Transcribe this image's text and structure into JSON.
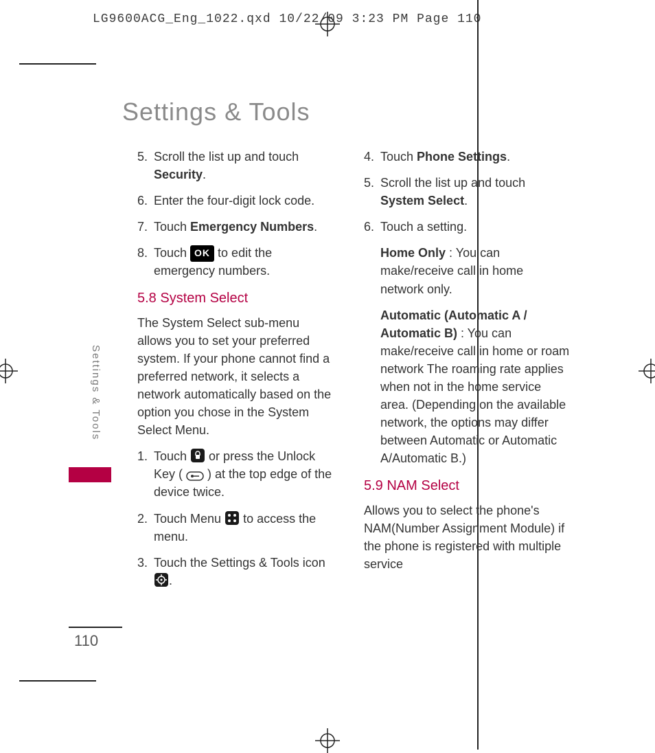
{
  "header_line": "LG9600ACG_Eng_1022.qxd  10/22/09  3:23 PM  Page 110",
  "title": "Settings & Tools",
  "side_tab": "Settings & Tools",
  "page_number": "110",
  "left": {
    "step5": {
      "n": "5.",
      "pre": "Scroll the list up and touch ",
      "bold": "Security",
      "post": "."
    },
    "step6": {
      "n": "6.",
      "body": "Enter the four-digit lock code."
    },
    "step7": {
      "n": "7.",
      "pre": "Touch ",
      "bold": "Emergency Numbers",
      "post": "."
    },
    "step8": {
      "n": "8.",
      "pre": "Touch ",
      "ok": "OK",
      "post": " to edit the emergency numbers."
    },
    "h58": "5.8 System Select",
    "p58": "The System Select sub-menu allows you to set your preferred system. If your phone cannot find a preferred network, it selects a network automatically based on the option you chose in the System Select Menu.",
    "s1": {
      "n": "1.",
      "pre": "Touch ",
      "mid": " or press the Unlock Key ( ",
      "post": " ) at the top edge of the device twice."
    },
    "s2": {
      "n": "2.",
      "pre": "Touch Menu ",
      "post": " to access the menu."
    },
    "s3": {
      "n": "3.",
      "pre": "Touch the Settings & Tools icon ",
      "post": "."
    }
  },
  "right": {
    "s4": {
      "n": "4.",
      "pre": "Touch ",
      "bold": "Phone Settings",
      "post": "."
    },
    "s5": {
      "n": "5.",
      "pre": "Scroll the list up and touch ",
      "bold": "System Select",
      "post": "."
    },
    "s6": {
      "n": "6.",
      "body": "Touch a setting."
    },
    "opt1_b": "Home Only",
    "opt1_t": " : You can make/receive call in home network only.",
    "opt2_b": "Automatic (Automatic A / Automatic B)",
    "opt2_t": " : You can make/receive call in home or roam network The roaming rate applies when not in the home service area. (Depending on the available network, the options may differ between Automatic or Automatic A/Automatic B.)",
    "h59": "5.9 NAM Select",
    "p59": "Allows you to select the phone's NAM(Number Assignment Module) if the phone is registered with multiple service"
  }
}
